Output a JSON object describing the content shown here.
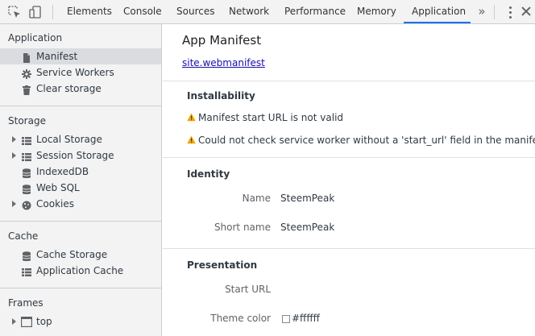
{
  "toolbar": {
    "tabs": [
      {
        "label": "Elements"
      },
      {
        "label": "Console"
      },
      {
        "label": "Sources"
      },
      {
        "label": "Network"
      },
      {
        "label": "Performance"
      },
      {
        "label": "Memory"
      },
      {
        "label": "Application"
      }
    ],
    "more_tabs_label": "»",
    "active_tab": "Application",
    "accent_color": "#1a73e8"
  },
  "sidebar": {
    "sections": [
      {
        "title": "Application",
        "items": [
          {
            "label": "Manifest",
            "icon": "file-icon",
            "selected": true
          },
          {
            "label": "Service Workers",
            "icon": "gear-icon"
          },
          {
            "label": "Clear storage",
            "icon": "trash-icon"
          }
        ]
      },
      {
        "title": "Storage",
        "items": [
          {
            "label": "Local Storage",
            "icon": "grid-icon",
            "expandable": true
          },
          {
            "label": "Session Storage",
            "icon": "grid-icon",
            "expandable": true
          },
          {
            "label": "IndexedDB",
            "icon": "database-icon"
          },
          {
            "label": "Web SQL",
            "icon": "database-icon"
          },
          {
            "label": "Cookies",
            "icon": "cookie-icon",
            "expandable": true
          }
        ]
      },
      {
        "title": "Cache",
        "items": [
          {
            "label": "Cache Storage",
            "icon": "database-icon"
          },
          {
            "label": "Application Cache",
            "icon": "grid-icon"
          }
        ]
      },
      {
        "title": "Frames",
        "items": [
          {
            "label": "top",
            "icon": "frame-icon",
            "expandable": true
          }
        ]
      }
    ]
  },
  "main": {
    "title": "App Manifest",
    "manifest_link": "site.webmanifest",
    "installability": {
      "heading": "Installability",
      "warnings": [
        "Manifest start URL is not valid",
        "Could not check service worker without a 'start_url' field in the manifest"
      ],
      "warning_color": "#f2a600"
    },
    "identity": {
      "heading": "Identity",
      "name_label": "Name",
      "name_value": "SteemPeak",
      "short_name_label": "Short name",
      "short_name_value": "SteemPeak"
    },
    "presentation": {
      "heading": "Presentation",
      "start_url_label": "Start URL",
      "start_url_value": "",
      "theme_color_label": "Theme color",
      "theme_color_value": "#ffffff"
    }
  }
}
